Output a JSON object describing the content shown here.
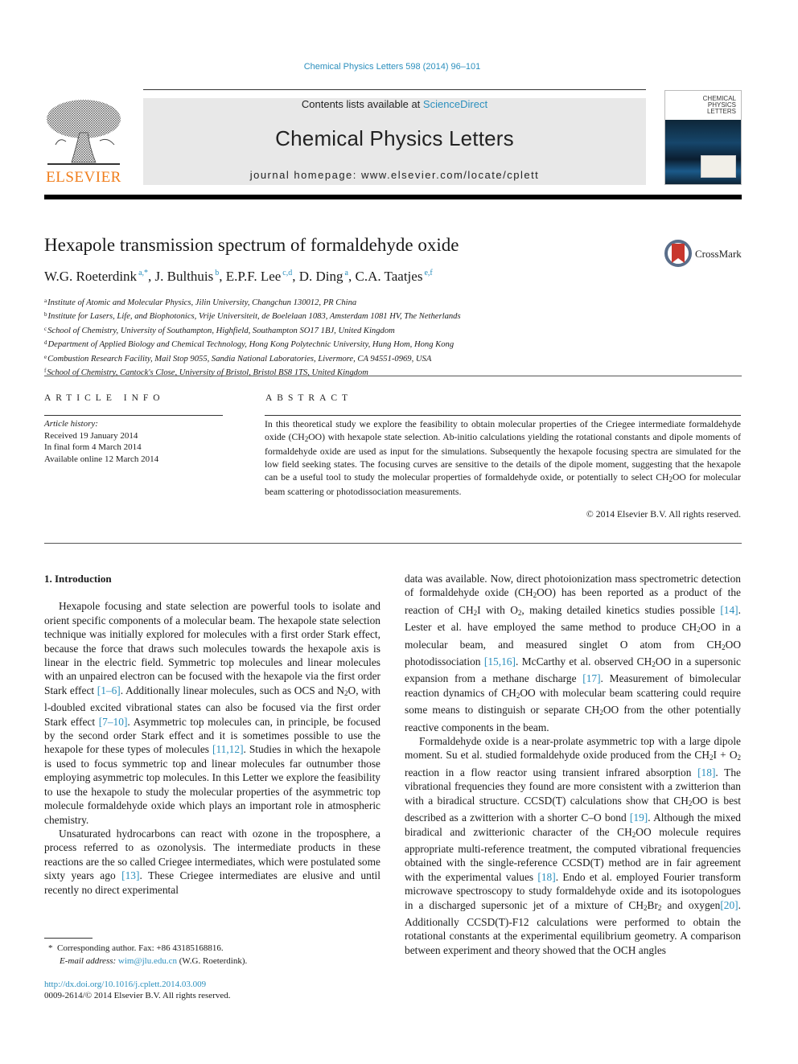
{
  "header": {
    "citation": "Chemical Physics Letters 598 (2014) 96–101",
    "contents_prefix": "Contents lists available at ",
    "contents_link": "ScienceDirect",
    "journal_name": "Chemical Physics Letters",
    "homepage": "journal homepage: www.elsevier.com/locate/cplett",
    "publisher": "ELSEVIER",
    "cover_title_lines": [
      "CHEMICAL",
      "PHYSICS",
      "LETTERS"
    ]
  },
  "article": {
    "title": "Hexapole transmission spectrum of formaldehyde oxide",
    "crossmark_label": "CrossMark",
    "authors": [
      {
        "name": "W.G. Roeterdink",
        "sup": "a,*"
      },
      {
        "name": "J. Bulthuis",
        "sup": "b"
      },
      {
        "name": "E.P.F. Lee",
        "sup": "c,d"
      },
      {
        "name": "D. Ding",
        "sup": "a"
      },
      {
        "name": "C.A. Taatjes",
        "sup": "e,f"
      }
    ],
    "affiliations": [
      {
        "key": "a",
        "text": "Institute of Atomic and Molecular Physics, Jilin University, Changchun 130012, PR China"
      },
      {
        "key": "b",
        "text": "Institute for Lasers, Life, and Biophotonics, Vrije Universiteit, de Boelelaan 1083, Amsterdam 1081 HV, The Netherlands"
      },
      {
        "key": "c",
        "text": "School of Chemistry, University of Southampton, Highfield, Southampton SO17 1BJ, United Kingdom"
      },
      {
        "key": "d",
        "text": "Department of Applied Biology and Chemical Technology, Hong Kong Polytechnic University, Hung Hom, Hong Kong"
      },
      {
        "key": "e",
        "text": "Combustion Research Facility, Mail Stop 9055, Sandia National Laboratories, Livermore, CA 94551-0969, USA"
      },
      {
        "key": "f",
        "text": "School of Chemistry, Cantock's Close, University of Bristol, Bristol BS8 1TS, United Kingdom"
      }
    ]
  },
  "article_info": {
    "heading": "ARTICLE INFO",
    "history_label": "Article history:",
    "received": "Received 19 January 2014",
    "final_form": "In final form 4 March 2014",
    "available_online": "Available online 12 March 2014"
  },
  "abstract": {
    "heading": "ABSTRACT",
    "text_1": "In this theoretical study we explore the feasibility to obtain molecular properties of the Criegee intermediate formaldehyde oxide (CH",
    "text_2": "OO) with hexapole state selection. Ab-initio calculations yielding the rotational constants and dipole moments of formaldehyde oxide are used as input for the simulations. Subsequently the hexapole focusing spectra are simulated for the low field seeking states. The focusing curves are sensitive to the details of the dipole moment, suggesting that the hexapole can be a useful tool to study the molecular properties of formaldehyde oxide, or potentially to select CH",
    "text_3": "OO for molecular beam scattering or photodissociation measurements.",
    "copyright": "© 2014 Elsevier B.V. All rights reserved."
  },
  "body": {
    "section_1_heading": "1. Introduction",
    "p1": [
      "Hexapole focusing and state selection are powerful tools to isolate and orient specific components of a molecular beam. The hexapole state selection technique was initially explored for molecules with a first order Stark effect, because the force that draws such molecules towards the hexapole axis is linear in the electric field. Symmetric top molecules and linear molecules with an unpaired electron can be focused with the hexapole via the first order Stark effect ",
      "[1–6]",
      ". Additionally linear molecules, such as OCS and N",
      "O, with l-doubled excited vibrational states can also be focused via the first order Stark effect ",
      "[7–10]",
      ". Asymmetric top molecules can, in principle, be focused by the second order Stark effect and it is sometimes possible to use the hexapole for these types of molecules ",
      "[11,12]",
      ". Studies in which the hexapole is used to focus symmetric top and linear molecules far outnumber those employing asymmetric top molecules. In this Letter we explore the feasibility to use the hexapole to study the molecular properties of the asymmetric top molecule formaldehyde oxide which plays an important role in atmospheric chemistry."
    ],
    "p2": [
      "Unsaturated hydrocarbons can react with ozone in the troposphere, a process referred to as ozonolysis. The intermediate products in these reactions are the so called Criegee intermediates, which were postulated some sixty years ago ",
      "[13]",
      ". These Criegee intermediates are elusive and until recently no direct experimental"
    ],
    "p3": [
      "data was available. Now, direct photoionization mass spectrometric detection of formaldehyde oxide (CH",
      "OO) has been reported as a product of the reaction of CH",
      "I with O",
      ", making detailed kinetics studies possible ",
      "[14]",
      ". Lester et al. have employed the same method to produce CH",
      "OO in a molecular beam, and measured singlet O atom from CH",
      "OO photodissociation ",
      "[15,16]",
      ". McCarthy et al. observed CH",
      "OO in a supersonic expansion from a methane discharge ",
      "[17]",
      ". Measurement of bimolecular reaction dynamics of CH",
      "OO with molecular beam scattering could require some means to distinguish or separate CH",
      "OO from the other potentially reactive components in the beam."
    ],
    "p4": [
      "Formaldehyde oxide is a near-prolate asymmetric top with a large dipole moment. Su et al. studied formaldehyde oxide produced from the CH",
      "I + O",
      " reaction in a flow reactor using transient infrared absorption ",
      "[18]",
      ". The vibrational frequencies they found are more consistent with a zwitterion than with a biradical structure. CCSD(T) calculations show that CH",
      "OO is best described as a zwitterion with a shorter C–O bond ",
      "[19]",
      ". Although the mixed biradical and zwitterionic character of the CH",
      "OO molecule requires appropriate multi-reference treatment, the computed vibrational frequencies obtained with the single-reference CCSD(T) method are in fair agreement with the experimental values ",
      "[18]",
      ". Endo et al. employed Fourier transform microwave spectroscopy to study formaldehyde oxide and its isotopologues in a discharged supersonic jet of a mixture of CH",
      "Br",
      " and oxygen",
      "[20]",
      ". Additionally CCSD(T)-F12 calculations were performed to obtain the rotational constants at the experimental equilibrium geometry. A comparison between experiment and theory showed that the OCH angles"
    ],
    "sub2": "2"
  },
  "footnotes": {
    "star": "*",
    "corresponding": "Corresponding author. Fax: +86 43185168816.",
    "email_label": "E-mail address: ",
    "email": "wim@jlu.edu.cn",
    "email_owner": " (W.G. Roeterdink).",
    "doi": "http://dx.doi.org/10.1016/j.cplett.2014.03.009",
    "issn": "0009-2614/© 2014 Elsevier B.V. All rights reserved."
  }
}
